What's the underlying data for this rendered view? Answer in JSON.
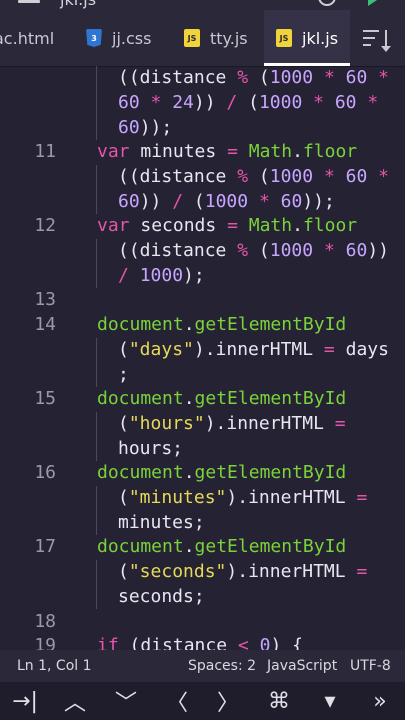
{
  "topbar": {
    "filename": "jkl.js"
  },
  "tabs": [
    {
      "label": "ac.html",
      "icon": "html-file-icon"
    },
    {
      "label": "jj.css",
      "icon": "css-file-icon"
    },
    {
      "label": "tty.js",
      "icon": "js-file-icon"
    },
    {
      "label": "jkl.js",
      "icon": "js-file-icon",
      "active": true
    }
  ],
  "colors": {
    "keyword": "#e356a8",
    "function": "#7ad33a",
    "number": "#c7a6ff",
    "string": "#e6d95a",
    "background": "#252233"
  },
  "line_numbers": [
    "11",
    "12",
    "13",
    "14",
    "15",
    "16",
    "17",
    "18",
    "19"
  ],
  "status": {
    "position": "Ln 1, Col 1",
    "spaces": "Spaces: 2",
    "language": "JavaScript",
    "encoding": "UTF-8"
  },
  "keys": [
    {
      "label": "→|",
      "name": "tab-key"
    },
    {
      "label": "︿",
      "name": "arrow-up-key"
    },
    {
      "label": "﹀",
      "name": "arrow-down-key"
    },
    {
      "label": "〈",
      "name": "arrow-left-key"
    },
    {
      "label": "〉",
      "name": "arrow-right-key"
    },
    {
      "label": "⌘",
      "name": "command-key"
    },
    {
      "label": "▾",
      "name": "dropdown-key"
    },
    {
      "label": "»",
      "name": "more-keys"
    }
  ]
}
